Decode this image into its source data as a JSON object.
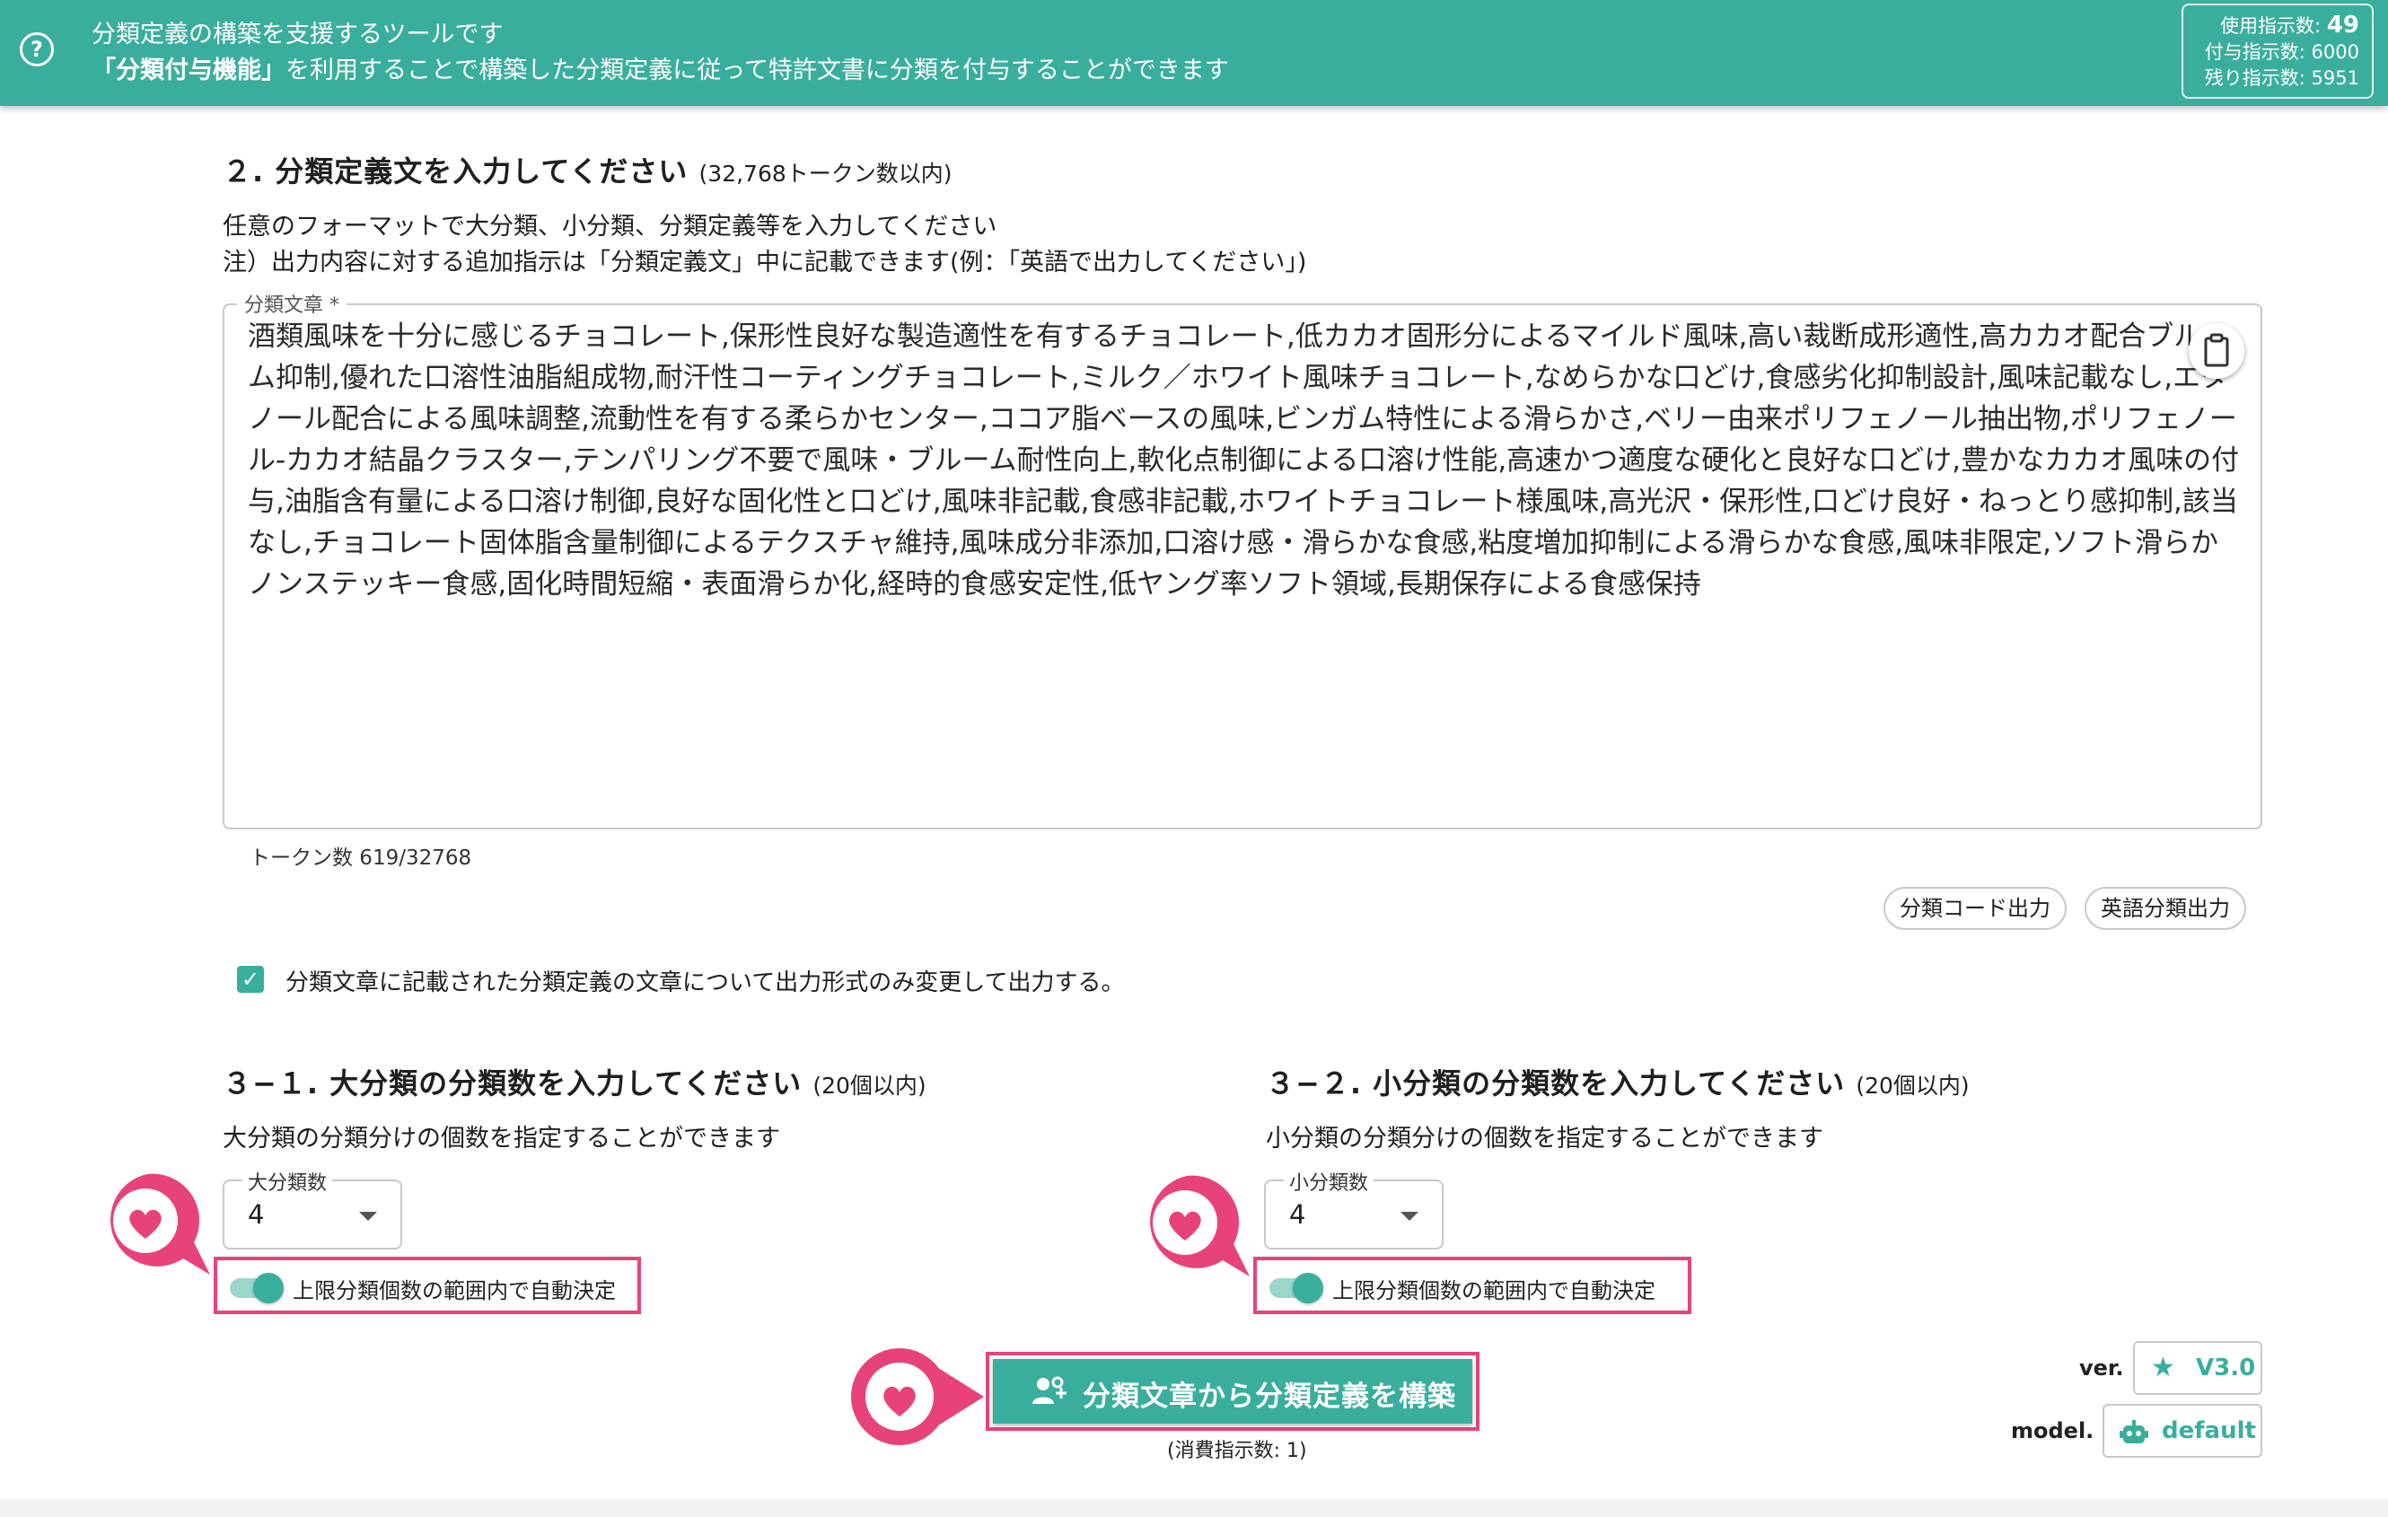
{
  "header": {
    "line1": "分類定義の構築を支援するツールです",
    "line2_bold": "「分類付与機能」",
    "line2_rest": "を利用することで構築した分類定義に従って特許文書に分類を付与することができます",
    "usage_label": "使用指示数:",
    "usage_value": "49",
    "grant_label": "付与指示数:",
    "grant_value": "6000",
    "remaining_label": "残り指示数:",
    "remaining_value": "5951"
  },
  "section2": {
    "title": "２. 分類定義文を入力してください",
    "note": "(32,768トークン数以内)",
    "desc1": "任意のフォーマットで大分類、小分類、分類定義等を入力してください",
    "desc2": "注）出力内容に対する追加指示は「分類定義文」中に記載できます(例：「英語で出力してください」)",
    "textarea_label": "分類文章 *",
    "textarea_value": "酒類風味を十分に感じるチョコレート,保形性良好な製造適性を有するチョコレート,低カカオ固形分によるマイルド風味,高い裁断成形適性,高カカオ配合ブルーム抑制,優れた口溶性油脂組成物,耐汗性コーティングチョコレート,ミルク／ホワイト風味チョコレート,なめらかな口どけ,食感劣化抑制設計,風味記載なし,エタノール配合による風味調整,流動性を有する柔らかセンター,ココア脂ベースの風味,ビンガム特性による滑らかさ,ベリー由来ポリフェノール抽出物,ポリフェノール-カカオ結晶クラスター,テンパリング不要で風味・ブルーム耐性向上,軟化点制御による口溶け性能,高速かつ適度な硬化と良好な口どけ,豊かなカカオ風味の付与,油脂含有量による口溶け制御,良好な固化性と口どけ,風味非記載,食感非記載,ホワイトチョコレート様風味,高光沢・保形性,口どけ良好・ねっとり感抑制,該当なし,チョコレート固体脂含量制御によるテクスチャ維持,風味成分非添加,口溶け感・滑らかな食感,粘度増加抑制による滑らかな食感,風味非限定,ソフト滑らかノンステッキー食感,固化時間短縮・表面滑らか化,経時的食感安定性,低ヤング率ソフト領域,長期保存による食感保持",
    "token_count": "トークン数 619/32768",
    "chip_code": "分類コード出力",
    "chip_english": "英語分類出力",
    "checkbox_label": "分類文章に記載された分類定義の文章について出力形式のみ変更して出力する。"
  },
  "section31": {
    "title": "３−１. 大分類の分類数を入力してください",
    "note": "(20個以内)",
    "desc": "大分類の分類分けの個数を指定することができます",
    "select_label": "大分類数",
    "select_value": "4",
    "toggle_label": "上限分類個数の範囲内で自動決定"
  },
  "section32": {
    "title": "３−２. 小分類の分類数を入力してください",
    "note": "(20個以内)",
    "desc": "小分類の分類分けの個数を指定することができます",
    "select_label": "小分類数",
    "select_value": "4",
    "toggle_label": "上限分類個数の範囲内で自動決定"
  },
  "actions": {
    "build_label": "分類文章から分類定義を構築",
    "consume_text": "(消費指示数: 1)",
    "ver_label": "ver.",
    "ver_value": "V3.0",
    "model_label": "model.",
    "model_value": "default"
  },
  "colors": {
    "brand": "#3aae9c",
    "highlight": "#e8427a"
  },
  "icons": [
    "help-circle-icon",
    "clipboard-icon",
    "check-icon",
    "chevron-down-icon",
    "heart-marker-icon",
    "people-icon",
    "star-icon",
    "robot-icon"
  ]
}
